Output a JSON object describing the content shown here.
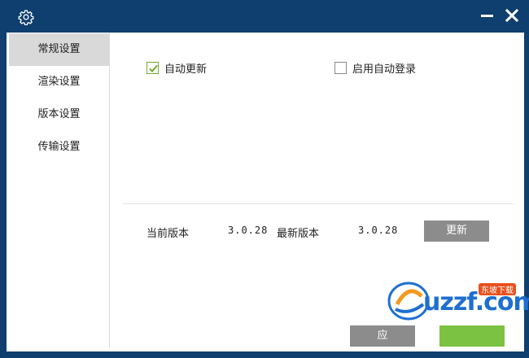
{
  "titlebar": {
    "icon": "gear-icon",
    "minimize_icon": "minimize-icon",
    "close_icon": "close-icon"
  },
  "sidebar": {
    "items": [
      {
        "label": "常规设置",
        "active": true
      },
      {
        "label": "渲染设置",
        "active": false
      },
      {
        "label": "版本设置",
        "active": false
      },
      {
        "label": "传输设置",
        "active": false
      }
    ]
  },
  "general": {
    "auto_update": {
      "label": "自动更新",
      "checked": true
    },
    "auto_login": {
      "label": "启用自动登录",
      "checked": false
    }
  },
  "version": {
    "current_label": "当前版本",
    "current_value": "3.0.28",
    "latest_label": "最新版本",
    "latest_value": "3.0.28",
    "update_button": "更新"
  },
  "footer": {
    "apply_button_partial": "应"
  },
  "watermark": {
    "text": "uzzf.com",
    "badge": "东坡下载"
  },
  "colors": {
    "titlebar": "#0e3f6e",
    "check_accent": "#74a92c",
    "button_gray": "#8c8c8c",
    "button_green": "#7cc242"
  }
}
